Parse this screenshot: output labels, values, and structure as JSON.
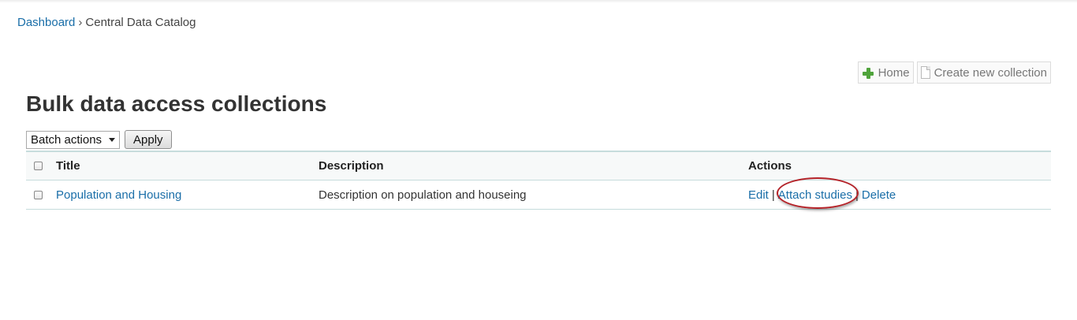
{
  "breadcrumb": {
    "root": "Dashboard",
    "separator": "›",
    "current": "Central Data Catalog"
  },
  "toolbar": {
    "home_label": "Home",
    "home_icon": "plus-icon",
    "create_label": "Create new collection",
    "create_icon": "document-icon"
  },
  "page": {
    "title": "Bulk data access collections"
  },
  "batch": {
    "selected": "Batch actions",
    "apply_label": "Apply"
  },
  "table": {
    "headers": {
      "title": "Title",
      "description": "Description",
      "actions": "Actions"
    },
    "rows": [
      {
        "title": "Population and Housing",
        "description": "Description on population and houseing",
        "actions": [
          "Edit",
          "Attach studies",
          "Delete"
        ]
      }
    ],
    "action_separator": "|"
  },
  "colors": {
    "link": "#1a6ea8",
    "highlight_ring": "#b42228",
    "table_border": "#c6dcdc"
  }
}
